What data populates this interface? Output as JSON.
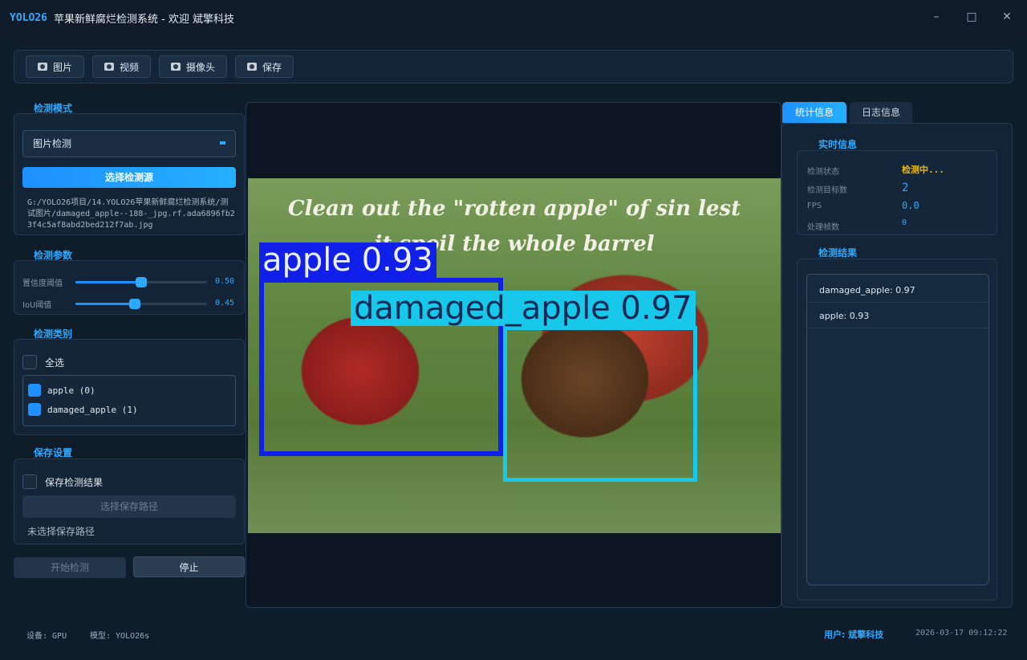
{
  "window": {
    "brand": "YOLO26",
    "title": "苹果新鲜腐烂检测系统 - 欢迎 斌擎科技",
    "controls": [
      "–",
      "□",
      "✕"
    ]
  },
  "toolbar": {
    "items": [
      {
        "label": "图片",
        "icon": "image-icon"
      },
      {
        "label": "视频",
        "icon": "video-icon"
      },
      {
        "label": "摄像头",
        "icon": "camera-icon"
      },
      {
        "label": "保存",
        "icon": "save-icon"
      }
    ]
  },
  "detection_mode": {
    "title": "检测模式",
    "selected": "图片检测",
    "select_source_label": "选择检测源",
    "path": "G:/YOLO26项目/14.YOLO26苹果新鲜腐烂检测系统/测试图片/damaged_apple--188-_jpg.rf.ada6896fb23f4c5af8abd2bed212f7ab.jpg"
  },
  "params": {
    "title": "检测参数",
    "confidence": {
      "label": "置信度阈值",
      "value": "0.50",
      "fraction": 0.5
    },
    "iou": {
      "label": "IoU阈值",
      "value": "0.45",
      "fraction": 0.45
    }
  },
  "classes": {
    "title": "检测类别",
    "select_all": "全选",
    "items": [
      "apple (0)",
      "damaged_apple (1)"
    ]
  },
  "save": {
    "title": "保存设置",
    "save_results": "保存检测结果",
    "choose_path": "选择保存路径",
    "path_status": "未选择保存路径"
  },
  "actions": {
    "start": "开始检测",
    "stop": "停止"
  },
  "image": {
    "caption_line1": "Clean out the \"rotten apple\" of sin lest",
    "caption_line2": "it spoil the whole barrel",
    "boxes": [
      {
        "label": "apple 0.93",
        "color": "#1020e8"
      },
      {
        "label": "damaged_apple 0.97",
        "color": "#18c8ea"
      }
    ]
  },
  "tabs": [
    "统计信息",
    "日志信息"
  ],
  "realtime": {
    "title": "实时信息",
    "rows": [
      {
        "label": "检测状态",
        "value": "检测中...",
        "color": "#f5b800"
      },
      {
        "label": "检测目标数",
        "value": "2",
        "color": "#2fa8ff"
      },
      {
        "label": "FPS",
        "value": "0.0",
        "color": "#2fa8ff"
      },
      {
        "label": "处理帧数",
        "value": "0",
        "color": "#2fa8ff"
      }
    ]
  },
  "results": {
    "title": "检测结果",
    "items": [
      "damaged_apple: 0.97",
      "apple: 0.93"
    ]
  },
  "status": {
    "device": "设备: GPU",
    "model": "模型: YOLO26s",
    "user": "用户: 斌擎科技",
    "time": "2026-03-17 09:12:22"
  }
}
